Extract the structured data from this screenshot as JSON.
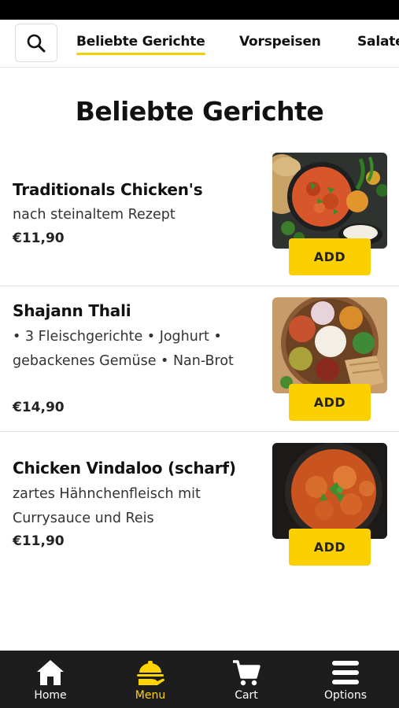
{
  "nav": {
    "tabs": [
      {
        "label": "Beliebte Gerichte",
        "active": true
      },
      {
        "label": "Vorspeisen",
        "active": false
      },
      {
        "label": "Salate",
        "active": false
      }
    ]
  },
  "page": {
    "title": "Beliebte Gerichte"
  },
  "items": [
    {
      "name": "Traditionals Chicken's",
      "description": "nach steinaltem Rezept",
      "price": "€11,90",
      "add_label": "ADD"
    },
    {
      "name": "Shajann Thali",
      "description": "• 3 Fleischgerichte • Joghurt • gebackenes Gemüse • Nan-Brot",
      "price": "€14,90",
      "add_label": "ADD"
    },
    {
      "name": "Chicken Vindaloo (scharf)",
      "description": "zartes Hähnchenfleisch mit Currysauce und Reis",
      "price": "€11,90",
      "add_label": "ADD"
    }
  ],
  "bottom_nav": [
    {
      "label": "Home",
      "icon": "home-icon",
      "active": false
    },
    {
      "label": "Menu",
      "icon": "food-tray-icon",
      "active": true
    },
    {
      "label": "Cart",
      "icon": "cart-icon",
      "active": false
    },
    {
      "label": "Options",
      "icon": "menu-icon",
      "active": false
    }
  ],
  "colors": {
    "accent": "#fcd000",
    "nav_bg": "#1d1d1d",
    "active_nav": "#ffd400"
  }
}
